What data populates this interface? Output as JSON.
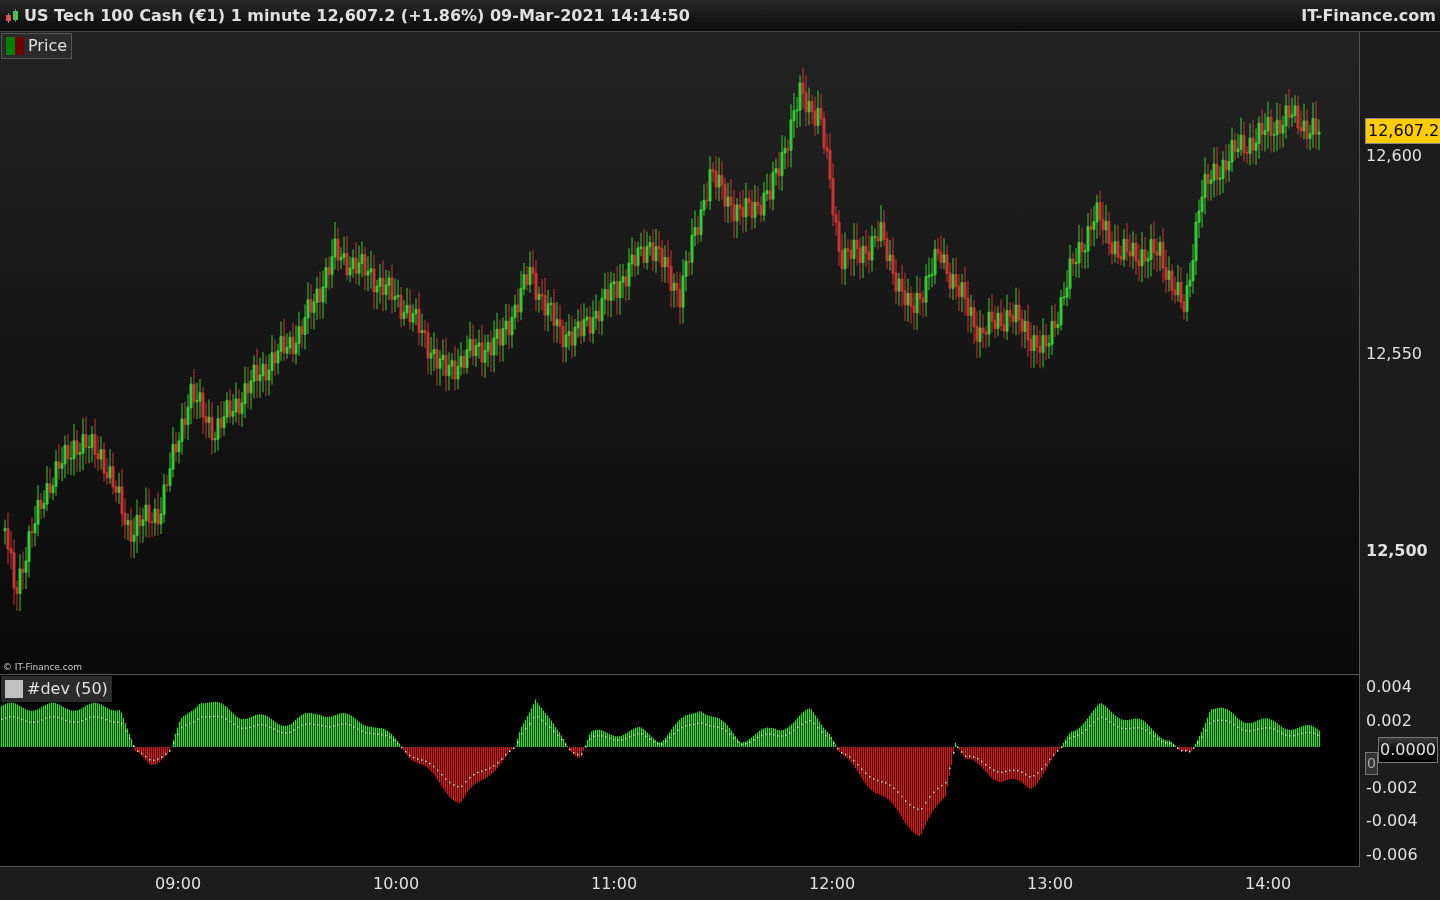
{
  "title_bar": {
    "title": "US Tech 100 Cash (€1) 1 minute 12,607.2 (+1.86%) 09-Mar-2021 14:14:50",
    "brand": "IT-Finance.com"
  },
  "price_panel": {
    "legend": "Price",
    "copyright": "© IT-Finance.com",
    "last_price": "12,607.2",
    "y_axis": [
      "12,600",
      "12,550",
      "12,500"
    ]
  },
  "indicator_panel": {
    "legend": "#dev (50)",
    "current_value": "0.0000",
    "marker": "0",
    "y_axis": [
      "0.004",
      "0.002",
      "-0.002",
      "-0.004",
      "-0.006"
    ]
  },
  "x_axis": [
    "09:00",
    "10:00",
    "11:00",
    "12:00",
    "13:00",
    "14:00"
  ]
}
